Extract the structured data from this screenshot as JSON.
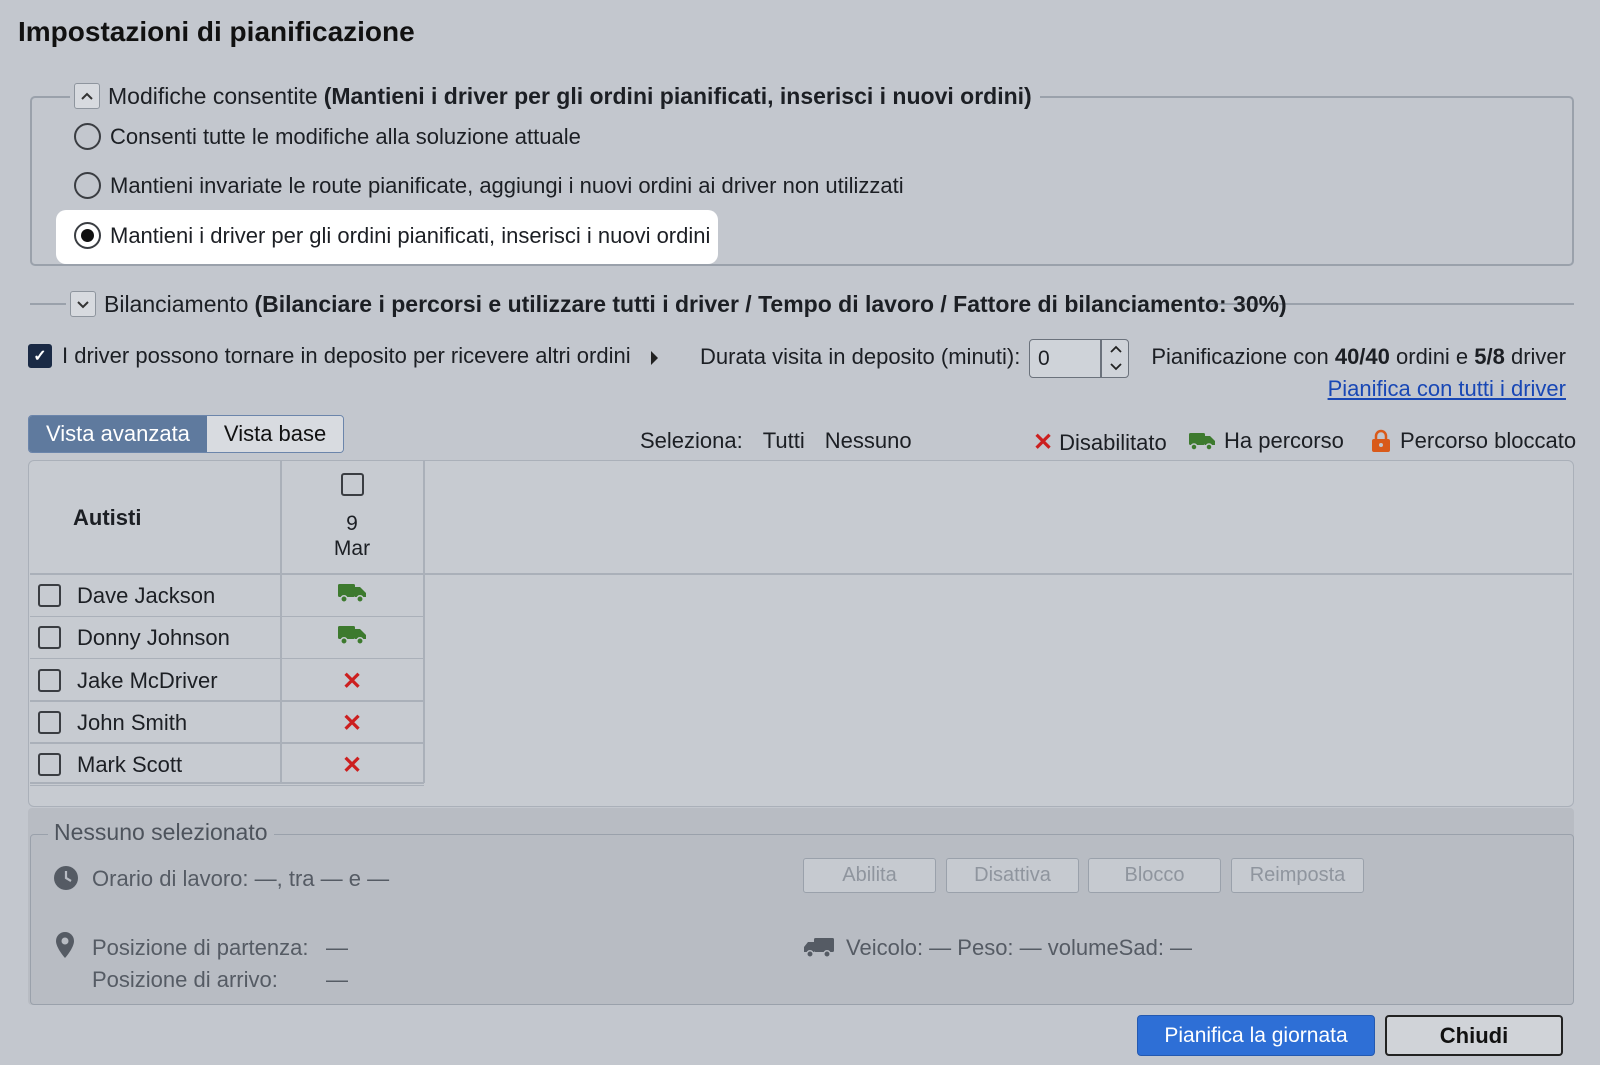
{
  "page_title": "Impostazioni di pianificazione",
  "modifiche": {
    "toggle_icon": "^",
    "label": "Modifiche consentite",
    "summary": "(Mantieni i driver per gli ordini pianificati, inserisci i nuovi ordini)",
    "options": [
      {
        "label": "Consenti tutte le modifiche alla soluzione attuale",
        "selected": false
      },
      {
        "label": "Mantieni invariate le route pianificate, aggiungi i nuovi ordini ai driver non utilizzati",
        "selected": false
      },
      {
        "label": "Mantieni i driver per gli ordini pianificati, inserisci i nuovi ordini",
        "selected": true
      }
    ]
  },
  "bilanciamento": {
    "toggle_icon": "v",
    "label": "Bilanciamento",
    "summary": "(Bilanciare i percorsi e utilizzare tutti i driver / Tempo di lavoro / Fattore di bilanciamento: 30%)"
  },
  "options_row": {
    "return_depot_label": "I driver possono tornare in deposito per ricevere altri ordini",
    "return_depot_checked": true,
    "duration_label": "Durata visita in deposito (minuti):",
    "duration_value": "0",
    "plan_prefix": "Pianificazione con ",
    "orders": "40/40",
    "orders_suffix": " ordini e ",
    "drivers": "5/8",
    "drivers_suffix": " driver",
    "plan_all_link": "Pianifica con tutti i driver"
  },
  "view": {
    "advanced": "Vista avanzata",
    "basic": "Vista base",
    "active": "advanced"
  },
  "select": {
    "label": "Seleziona:",
    "all": "Tutti",
    "none": "Nessuno"
  },
  "legend": {
    "disabled": "Disabilitato",
    "has_route": "Ha percorso",
    "locked": "Percorso bloccato"
  },
  "grid": {
    "header_label": "Autisti",
    "date_day": "9",
    "date_month": "Mar",
    "drivers": [
      {
        "name": "Dave Jackson",
        "status": "has_route"
      },
      {
        "name": "Donny Johnson",
        "status": "has_route"
      },
      {
        "name": "Jake McDriver",
        "status": "disabled"
      },
      {
        "name": "John Smith",
        "status": "disabled"
      },
      {
        "name": "Mark Scott",
        "status": "disabled"
      }
    ]
  },
  "detail": {
    "title": "Nessuno selezionato",
    "work_hours": "Orario di lavoro:  —, tra  —  e  —",
    "start_label": "Posizione di partenza:",
    "start_value": "—",
    "end_label": "Posizione di arrivo:",
    "end_value": "—",
    "vehicle": "Veicolo:  —   Peso:  —   volumeSad:  —",
    "buttons": [
      "Abilita",
      "Disattiva",
      "Blocco",
      "Reimposta"
    ]
  },
  "footer": {
    "plan_day": "Pianifica la giornata",
    "close": "Chiudi"
  },
  "colors": {
    "accent": "#2e6fd6",
    "link": "#1847b5",
    "route_green": "#3d7a2e",
    "disabled_red": "#cc1f1f",
    "locked_orange": "#d95a1a",
    "view_active": "#5f7a9e"
  }
}
